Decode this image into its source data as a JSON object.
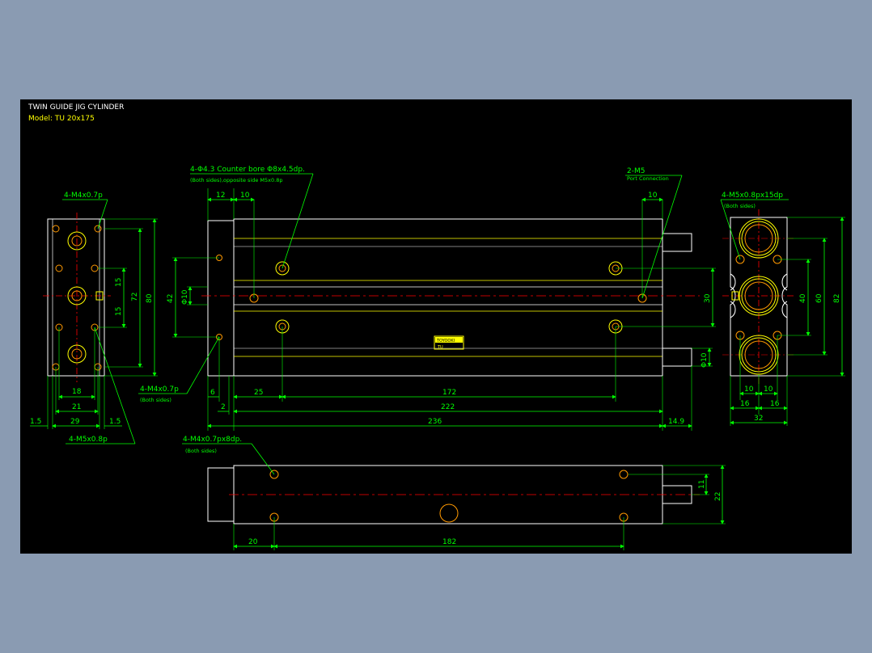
{
  "title": {
    "line1": "TWIN GUIDE JIG CYLINDER",
    "line2": "Model: TU 20x175"
  },
  "colors": {
    "background": "#000000",
    "body": "#ffffff",
    "dimension": "#00ff00",
    "centerline": "#ff0000",
    "hidden": "#ffff00",
    "port": "#ff9900",
    "desktop": "#8a9bb2"
  },
  "notes": {
    "counterbore_main": "4-Φ4.3 Counter bore Φ8x4.5dp.",
    "counterbore_sub": "(Both sides),opposite side M5x0.8p",
    "port_main": "2-M5",
    "port_sub": "Port Connection",
    "left_top_thread": "4-M4x0.7p",
    "left_bottom_thread": "4-M5x0.8p",
    "front_thread_main": "4-M4x0.7p",
    "front_thread_sub": "(Both sides)",
    "right_thread_main": "4-M5x0.8px15dp",
    "right_thread_sub": "(Both sides)",
    "bottom_thread_main": "4-M4x0.7px8dp.",
    "bottom_thread_sub": "(Both sides)"
  },
  "dimensions": {
    "left_view": {
      "h80": "80",
      "h72": "72",
      "h15a": "15",
      "h15b": "15",
      "w18": "18",
      "w21": "21",
      "w29": "29",
      "w1_5a": "1.5",
      "w1_5b": "1.5"
    },
    "front_view": {
      "d12": "12",
      "d10a": "10",
      "d10b": "10",
      "h42": "42",
      "dia10a": "Φ10",
      "h30": "30",
      "dia10b": "Φ10",
      "d6": "6",
      "d25": "25",
      "d172": "172",
      "d2": "2",
      "d222": "222",
      "d236": "236",
      "d14_9": "14.9"
    },
    "right_view": {
      "h40": "40",
      "h60": "60",
      "h82": "82",
      "w10a": "10",
      "w10b": "10",
      "w16a": "16",
      "w16b": "16",
      "w32": "32"
    },
    "bottom_view": {
      "h11": "11",
      "h22": "22",
      "d20": "20",
      "d182": "182"
    }
  },
  "label_plate": {
    "top": "TOYOOKI",
    "bottom": "TU"
  }
}
